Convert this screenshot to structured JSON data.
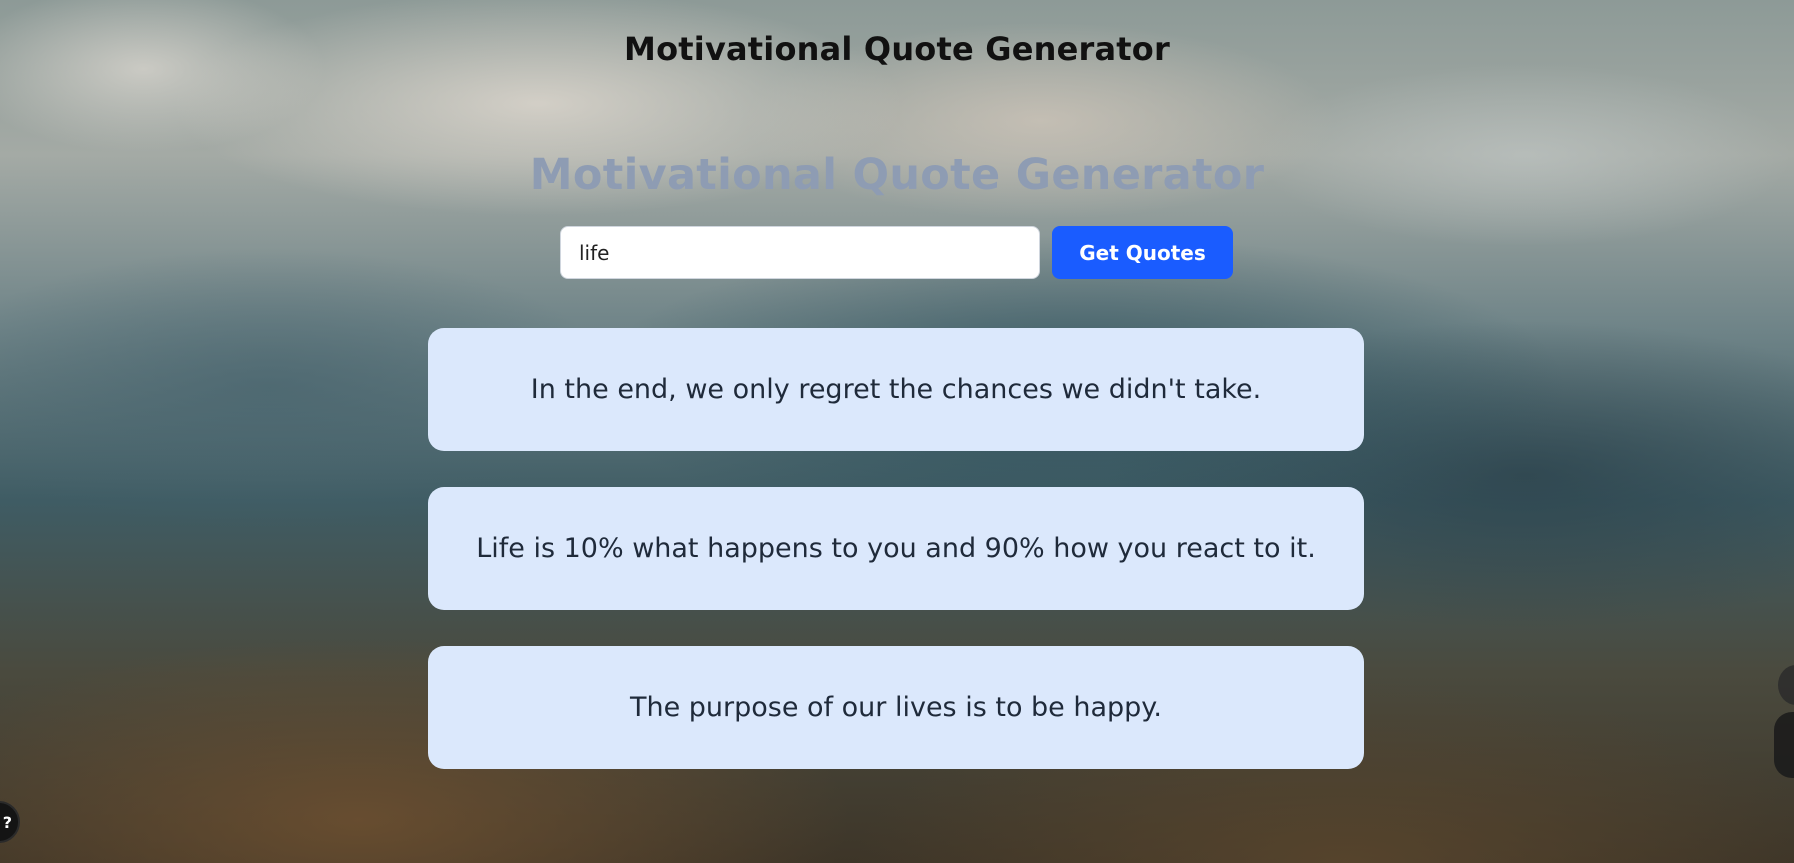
{
  "header": {
    "title": "Motivational Quote Generator"
  },
  "main": {
    "title": "Motivational Quote Generator",
    "search": {
      "value": "life",
      "placeholder": ""
    },
    "button_label": "Get Quotes",
    "quotes": [
      {
        "text": "In the end, we only regret the chances we didn't take."
      },
      {
        "text": "Life is 10% what happens to you and 90% how you react to it."
      },
      {
        "text": "The purpose of our lives is to be happy."
      }
    ]
  },
  "colors": {
    "accent": "#1a5cff",
    "card": "#dbe8fc",
    "title_muted": "#8e9cb3"
  },
  "widgets": {
    "corner_left_icon": "chat-bubble-icon",
    "corner_left_glyph": "?"
  }
}
